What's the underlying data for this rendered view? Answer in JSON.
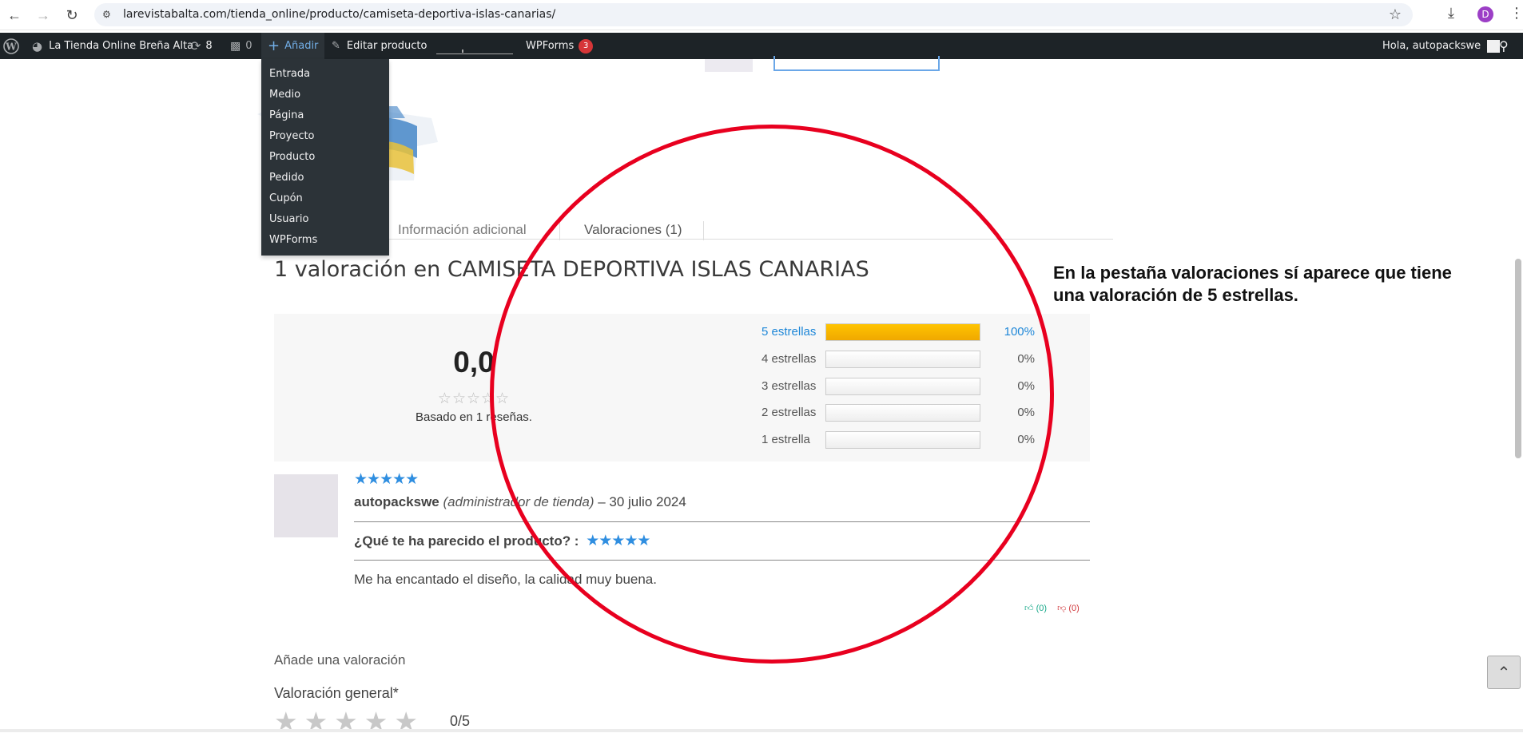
{
  "browser": {
    "url": "larevistabalta.com/tienda_online/producto/camiseta-deportiva-islas-canarias/",
    "avatar_letter": "D"
  },
  "adminbar": {
    "site_name": "La Tienda Online Breña Alta",
    "updates_count": "8",
    "comments_count": "0",
    "add_label": "Añadir",
    "edit_label": "Editar producto",
    "wpforms_label": "WPForms",
    "wpforms_badge": "3",
    "greeting": "Hola, autopackswe"
  },
  "add_menu": {
    "items": [
      "Entrada",
      "Medio",
      "Página",
      "Proyecto",
      "Producto",
      "Pedido",
      "Cupón",
      "Usuario",
      "WPForms"
    ]
  },
  "tabs": {
    "info": "Información adicional",
    "reviews": "Valoraciones (1)"
  },
  "reviews": {
    "title": "1 valoración en CAMISETA DEPORTIVA ISLAS CANARIAS",
    "average": "0,0",
    "average_stars": "☆☆☆☆☆",
    "based_on": "Basado en 1 reseñas.",
    "bars": [
      {
        "label": "5 estrellas",
        "pct": "100%",
        "fill": 1.0
      },
      {
        "label": "4 estrellas",
        "pct": "0%",
        "fill": 0
      },
      {
        "label": "3 estrellas",
        "pct": "0%",
        "fill": 0
      },
      {
        "label": "2 estrellas",
        "pct": "0%",
        "fill": 0
      },
      {
        "label": "1 estrella",
        "pct": "0%",
        "fill": 0
      }
    ],
    "item": {
      "stars": "★★★★★",
      "author": "autopackswe",
      "role": "(administrador de tienda)",
      "date": "– 30 julio 2024",
      "question": "¿Qué te ha parecido el producto? :",
      "question_stars": "★★★★★",
      "comment": "Me ha encantado el diseño, la calidad muy buena.",
      "votes_up": "(0)",
      "votes_down": "(0)"
    }
  },
  "add_review": {
    "heading": "Añade una valoración",
    "rating_label": "Valoración general",
    "required_mark": "*",
    "rating_stars": "★★★★★",
    "rating_value": "0/5"
  },
  "annotation": {
    "text": "En la pestaña valoraciones sí aparece que tiene una valoración de 5 estrellas."
  },
  "colors": {
    "highlight_circle": "#e8001f",
    "bar_fill": "#ffc400",
    "accent_blue": "#1e87d8"
  }
}
